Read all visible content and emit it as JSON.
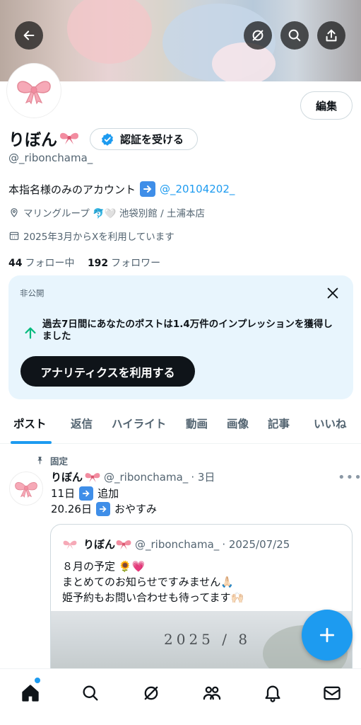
{
  "profile": {
    "display_name": "りぼん",
    "handle": "@_ribonchama_",
    "edit_label": "編集",
    "verify_label": "認証を受ける",
    "bio_prefix": "本指名様のみのアカウント",
    "bio_mention": "@_20104202_",
    "location": "マリングループ 🐬🤍 池袋別館 / 土浦本店",
    "joined": "2025年3月からXを利用しています",
    "following_count": "44",
    "following_label": "フォロー中",
    "followers_count": "192",
    "followers_label": "フォロワー"
  },
  "analytics": {
    "private_label": "非公開",
    "message": "過去7日間にあなたのポストは1.4万件のインプレッションを獲得しました",
    "button_label": "アナリティクスを利用する"
  },
  "tabs": [
    {
      "label": "ポスト"
    },
    {
      "label": "返信"
    },
    {
      "label": "ハイライト"
    },
    {
      "label": "動画"
    },
    {
      "label": "画像"
    },
    {
      "label": "記事"
    },
    {
      "label": "いいね"
    }
  ],
  "post": {
    "pinned_label": "固定",
    "name": "りぼん",
    "handle": "@_ribonchama_",
    "time": "· 3日",
    "line1_prefix": "11日",
    "line1_suffix": "追加",
    "line2_prefix": "20.26日",
    "line2_suffix": "おやすみ"
  },
  "quote": {
    "name": "りぼん",
    "handle": "@_ribonchama_",
    "date": "· 2025/07/25",
    "line1": "８月の予定 🌻💗",
    "line2": "まとめてのお知らせですみません🙏🏻",
    "line3": "姫予約もお問い合わせも待ってます🙌🏻",
    "image_text": "2025 / 8"
  },
  "colors": {
    "accent": "#1d9bf0",
    "text": "#0f1419",
    "muted": "#536471",
    "card_bg": "#e8f5fd"
  },
  "icons": {
    "back": "arrow-left-icon",
    "grok": "grok-icon",
    "search": "search-icon",
    "share": "share-icon",
    "close": "close-icon",
    "trend": "trending-up-icon",
    "pin": "pin-icon",
    "compose": "plus-icon",
    "nav": [
      "home-icon",
      "search-icon",
      "grok-icon",
      "communities-icon",
      "notifications-icon",
      "messages-icon"
    ]
  }
}
